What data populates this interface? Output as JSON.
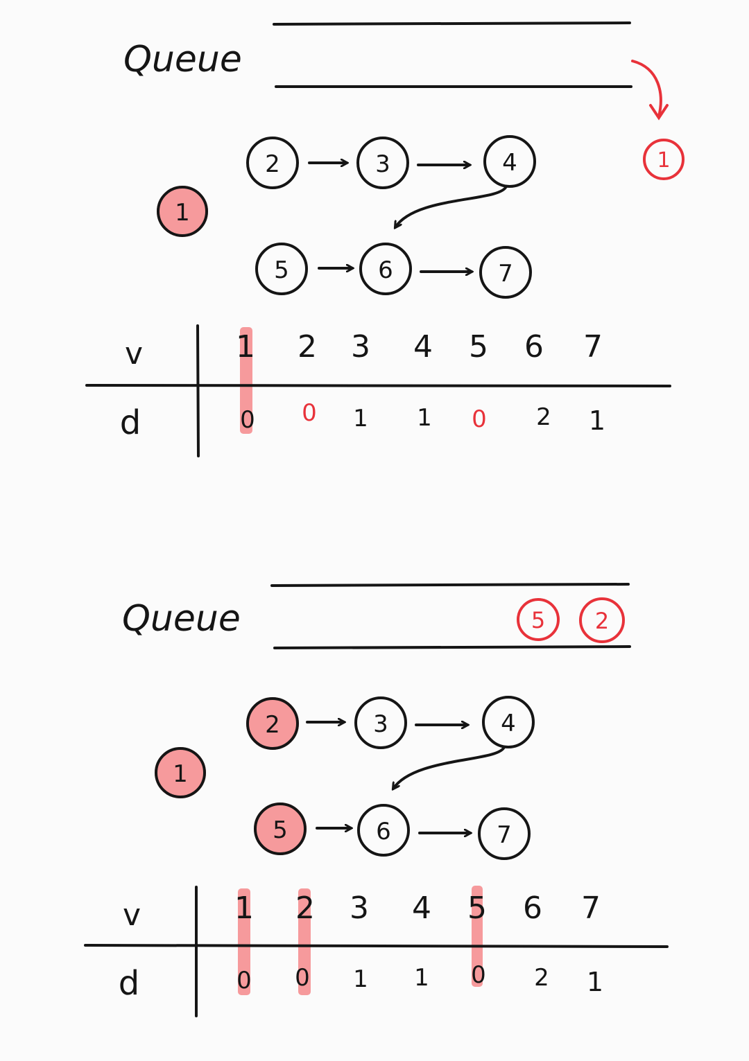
{
  "colors": {
    "ink": "#151515",
    "red": "#e8323a",
    "highlight": "#f47a7c",
    "background": "#fbfbfb"
  },
  "panels": [
    {
      "queue_label": "Queue",
      "queue_contents": [],
      "incoming_label": "1",
      "start_node_label": "1",
      "nodes": [
        "2",
        "3",
        "4",
        "5",
        "6",
        "7"
      ],
      "highlighted_nodes": [],
      "table": {
        "row_labels": [
          "v",
          "d"
        ],
        "v": [
          "1",
          "2",
          "3",
          "4",
          "5",
          "6",
          "7"
        ],
        "d": [
          "0",
          "0",
          "1",
          "1",
          "0",
          "2",
          "1"
        ],
        "red_d_indices": [
          1,
          4
        ],
        "highlighted_columns": [
          0
        ]
      }
    },
    {
      "queue_label": "Queue",
      "queue_contents": [
        "5",
        "2"
      ],
      "start_node_label": "1",
      "nodes": [
        "2",
        "3",
        "4",
        "5",
        "6",
        "7"
      ],
      "highlighted_nodes": [
        "2",
        "5"
      ],
      "table": {
        "row_labels": [
          "v",
          "d"
        ],
        "v": [
          "1",
          "2",
          "3",
          "4",
          "5",
          "6",
          "7"
        ],
        "d": [
          "0",
          "0",
          "1",
          "1",
          "0",
          "2",
          "1"
        ],
        "red_d_indices": [],
        "highlighted_columns": [
          0,
          1,
          4
        ]
      }
    }
  ]
}
